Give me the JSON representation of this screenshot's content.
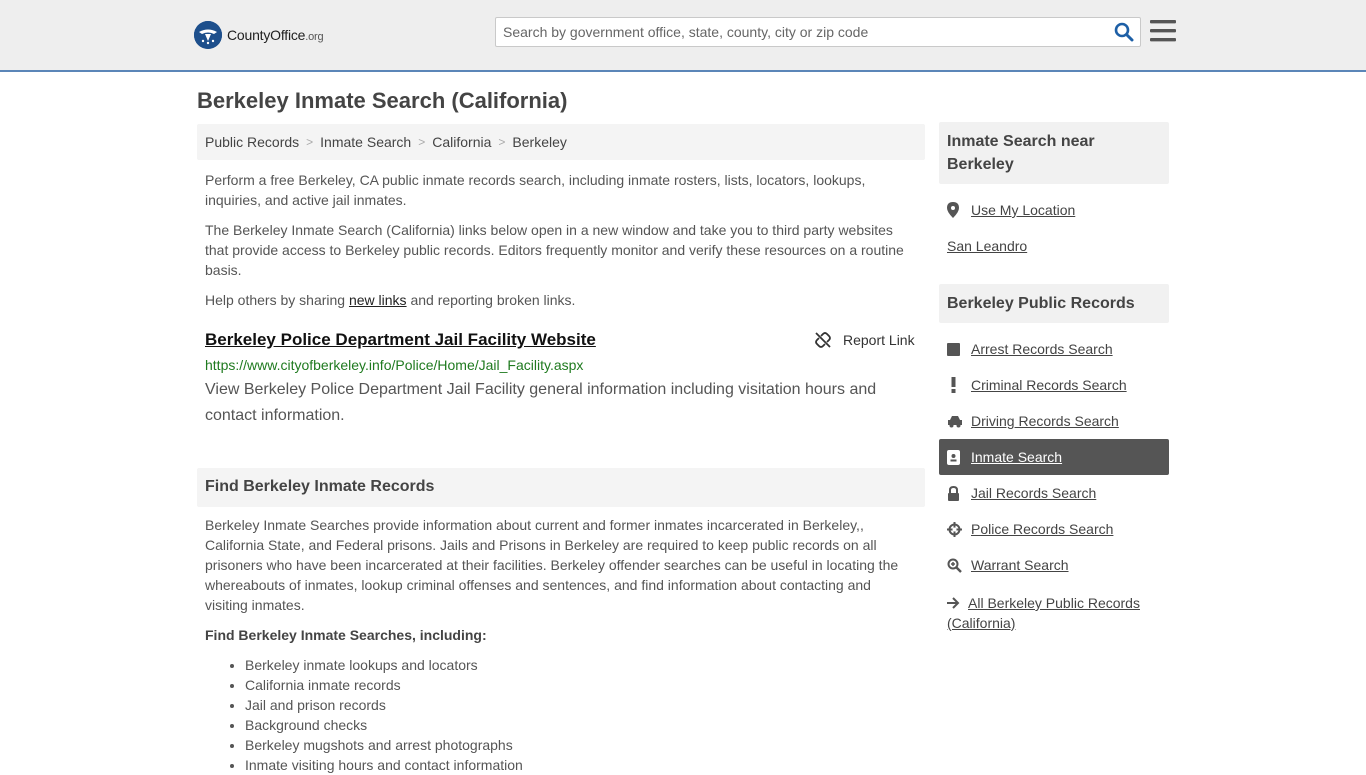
{
  "header": {
    "logo_main": "CountyOffice",
    "logo_tld": ".org",
    "search_placeholder": "Search by government office, state, county, city or zip code"
  },
  "page": {
    "title": "Berkeley Inmate Search (California)"
  },
  "breadcrumb": [
    "Public Records",
    "Inmate Search",
    "California",
    "Berkeley"
  ],
  "intro": {
    "p1": "Perform a free Berkeley, CA public inmate records search, including inmate rosters, lists, locators, lookups, inquiries, and active jail inmates.",
    "p2": "The Berkeley Inmate Search (California) links below open in a new window and take you to third party websites that provide access to Berkeley public records. Editors frequently monitor and verify these resources on a routine basis.",
    "p3_before": "Help others by sharing ",
    "p3_link": "new links",
    "p3_after": " and reporting broken links."
  },
  "result": {
    "title": "Berkeley Police Department Jail Facility Website",
    "url": "https://www.cityofberkeley.info/Police/Home/Jail_Facility.aspx",
    "description": "View Berkeley Police Department Jail Facility general information including visitation hours and contact information.",
    "report_label": "Report Link"
  },
  "find": {
    "heading": "Find Berkeley Inmate Records",
    "body": "Berkeley Inmate Searches provide information about current and former inmates incarcerated in Berkeley,, California State, and Federal prisons. Jails and Prisons in Berkeley are required to keep public records on all prisoners who have been incarcerated at their facilities. Berkeley offender searches can be useful in locating the whereabouts of inmates, lookup criminal offenses and sentences, and find information about contacting and visiting inmates.",
    "subheading": "Find Berkeley Inmate Searches, including:",
    "items": [
      "Berkeley inmate lookups and locators",
      "California inmate records",
      "Jail and prison records",
      "Background checks",
      "Berkeley mugshots and arrest photographs",
      "Inmate visiting hours and contact information"
    ]
  },
  "sidebar": {
    "near_heading": "Inmate Search near Berkeley",
    "use_location": "Use My Location",
    "nearby": "San Leandro",
    "records_heading": "Berkeley Public Records",
    "records": [
      {
        "label": "Arrest Records Search",
        "icon": "square-icon"
      },
      {
        "label": "Criminal Records Search",
        "icon": "exclamation-icon"
      },
      {
        "label": "Driving Records Search",
        "icon": "car-icon"
      },
      {
        "label": "Inmate Search",
        "icon": "badge-icon",
        "active": true
      },
      {
        "label": "Jail Records Search",
        "icon": "lock-icon"
      },
      {
        "label": "Police Records Search",
        "icon": "crosshair-icon"
      },
      {
        "label": "Warrant Search",
        "icon": "magnify-icon"
      }
    ],
    "all_records": "All Berkeley Public Records (California)"
  }
}
